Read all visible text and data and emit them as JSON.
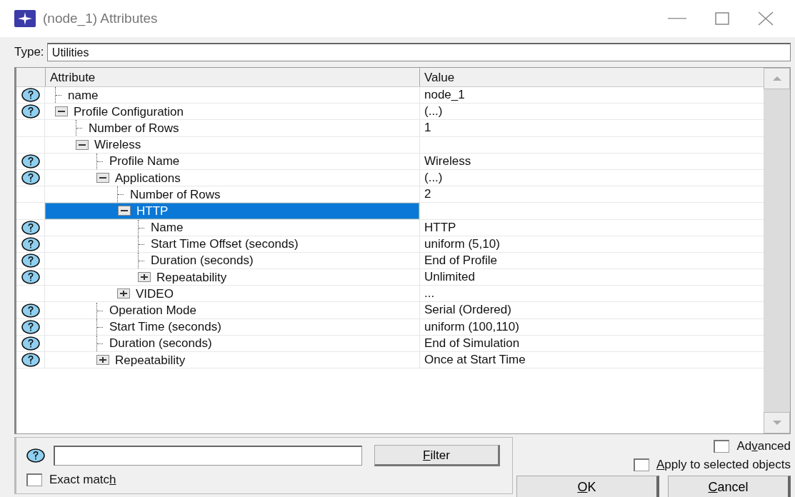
{
  "window": {
    "title": "(node_1) Attributes"
  },
  "type_field": {
    "label": "Type:",
    "value": "Utilities"
  },
  "table": {
    "columns": [
      "Attribute",
      "Value"
    ],
    "rows": [
      {
        "label": "name",
        "value": "node_1",
        "help": true,
        "selected": false
      },
      {
        "label": "Profile Configuration",
        "value": "(...)",
        "help": true,
        "expanded": true,
        "selected": false,
        "children": [
          {
            "label": "Number of Rows",
            "value": "1",
            "help": false,
            "selected": false
          },
          {
            "label": "Wireless",
            "help": false,
            "expanded": true,
            "selected": false,
            "children": [
              {
                "label": "Profile Name",
                "value": "Wireless",
                "help": true,
                "selected": false
              },
              {
                "label": "Applications",
                "value": "(...)",
                "help": true,
                "expanded": true,
                "selected": false,
                "children": [
                  {
                    "label": "Number of Rows",
                    "value": "2",
                    "help": false,
                    "selected": false
                  },
                  {
                    "label": "HTTP",
                    "help": false,
                    "expanded": true,
                    "selected": true,
                    "children": [
                      {
                        "label": "Name",
                        "value": "HTTP",
                        "help": true,
                        "selected": false
                      },
                      {
                        "label": "Start Time Offset (seconds)",
                        "value": "uniform (5,10)",
                        "help": true,
                        "selected": false
                      },
                      {
                        "label": "Duration (seconds)",
                        "value": "End of Profile",
                        "help": true,
                        "selected": false
                      },
                      {
                        "label": "Repeatability",
                        "value": "Unlimited",
                        "help": true,
                        "expanded": false,
                        "selected": false
                      }
                    ]
                  },
                  {
                    "label": "VIDEO",
                    "value": "...",
                    "help": false,
                    "expanded": false,
                    "selected": false
                  }
                ]
              },
              {
                "label": "Operation Mode",
                "value": "Serial (Ordered)",
                "help": true,
                "selected": false
              },
              {
                "label": "Start Time (seconds)",
                "value": "uniform (100,110)",
                "help": true,
                "selected": false
              },
              {
                "label": "Duration (seconds)",
                "value": "End of Simulation",
                "help": true,
                "selected": false
              },
              {
                "label": "Repeatability",
                "value": "Once at Start Time",
                "help": true,
                "expanded": false,
                "selected": false
              }
            ]
          }
        ]
      }
    ]
  },
  "filter": {
    "button": {
      "access_key": "F",
      "label_end": "ilter"
    },
    "exact_match": {
      "label_start": "Exact matc",
      "access_key": "h",
      "checked": false
    }
  },
  "options": [
    {
      "label_start": "Ad",
      "access_key": "v",
      "label_end": "anced",
      "checked": false
    },
    {
      "access_key": "A",
      "label_end": "pply to selected objects",
      "checked": false
    }
  ],
  "buttons": [
    {
      "access_key": "O",
      "label_end": "K"
    },
    {
      "access_key": "C",
      "label_end": "ancel"
    }
  ]
}
